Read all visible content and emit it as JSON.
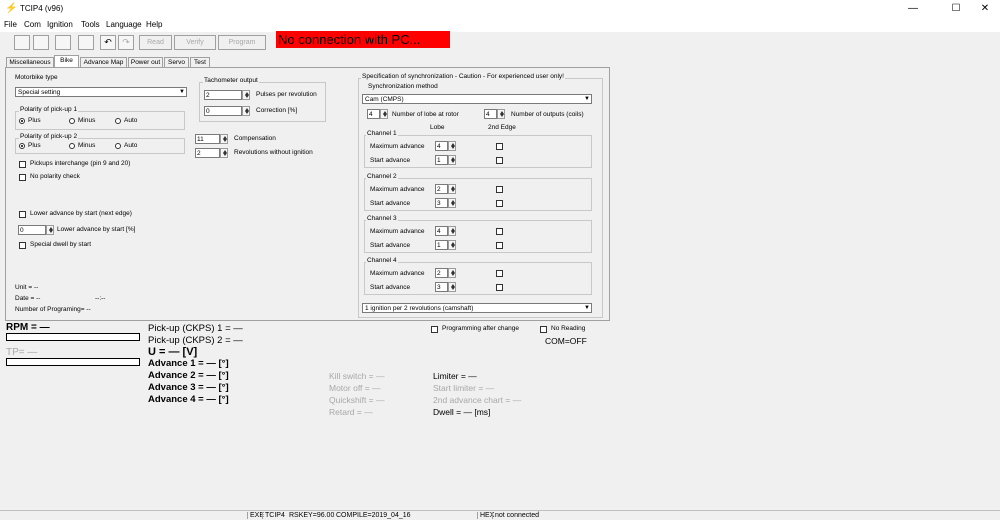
{
  "app": {
    "title": "TCIP4 (v96)"
  },
  "menu": [
    "File",
    "Com",
    "Ignition",
    "Tools",
    "Language",
    "Help"
  ],
  "toolbar": {
    "read": "Read",
    "verify": "Verify",
    "program": "Program",
    "connection_status": "No connection with PC..."
  },
  "tabs": [
    "Miscellaneous",
    "Bike",
    "Advance Map",
    "Power out",
    "Servo",
    "Test"
  ],
  "bike": {
    "motorbike_type_label": "Motorbike type",
    "motorbike_type": "Special setting",
    "polarity1_label": "Polarity of pick-up 1",
    "polarity2_label": "Polarity of pick-up 2",
    "polarity_options": [
      "Plus",
      "Minus",
      "Auto"
    ],
    "pickups_interchange": "Pickups interchange (pin 9 and 20)",
    "no_polarity_check": "No polarity check",
    "lower_advance_next_edge": "Lower advance by start (next edge)",
    "lower_advance_value": "0",
    "lower_advance_label": "Lower advance by start [%]",
    "special_dwell": "Special dwell by start",
    "unit": "Unit = --",
    "date": "Date = --",
    "date_time": "--:--",
    "num_programming": "Number of Programing= --",
    "tacho_label": "Tachometer output",
    "pulses_value": "2",
    "pulses_label": "Pulses per revolution",
    "correction_value": "0",
    "correction_label": "Correction [%]",
    "compensation_value": "11",
    "compensation_label": "Compensation",
    "rev_without_value": "2",
    "rev_without_label": "Revolutions without ignition"
  },
  "sync": {
    "title": "Specification of synchronization - Caution - For experienced user only!",
    "method_label": "Synchronization method",
    "method": "Cam (CMPS)",
    "lobe_value": "4",
    "lobe_label": "Number of lobe at rotor",
    "outputs_value": "4",
    "outputs_label": "Number of outputs (coils)",
    "col_lobe": "Lobe",
    "col_2nd": "2nd Edge",
    "max_label": "Maximum advance",
    "start_label": "Start advance",
    "channels": [
      {
        "name": "Channel 1",
        "max": "4",
        "start": "1"
      },
      {
        "name": "Channel 2",
        "max": "2",
        "start": "3"
      },
      {
        "name": "Channel 3",
        "max": "4",
        "start": "1"
      },
      {
        "name": "Channel 4",
        "max": "2",
        "start": "3"
      }
    ],
    "ignition_mode": "1 ignition per 2 revolutions (camshaft)"
  },
  "monitor": {
    "rpm": "RPM = —",
    "tp": "TP= —",
    "ckps1": "Pick-up (CKPS) 1 = —",
    "ckps2": "Pick-up (CKPS) 2 = —",
    "voltage": "U = — [V]",
    "adv1": "Advance 1 = — [°]",
    "adv2": "Advance 2 = — [°]",
    "adv3": "Advance 3 = — [°]",
    "adv4": "Advance 4 = — [°]",
    "kill": "Kill switch = —",
    "motor_off": "Motor off = —",
    "quickshift": "Quickshift = —",
    "retard": "Retard = —",
    "limiter": "Limiter = —",
    "start_limiter": "Start limiter = —",
    "adv_chart2": "2nd advance chart = —",
    "dwell": "Dwell = — [ms]",
    "prog_after_change": "Programming after change",
    "no_reading": "No Reading",
    "com": "COM=OFF"
  },
  "status": {
    "exe": "EXE",
    "tcip4": "TCIP4",
    "rskey": "RSKEY=96.00",
    "compile": "COMPILE=2019_04_16",
    "hex": "HEX",
    "conn": "not connected"
  }
}
